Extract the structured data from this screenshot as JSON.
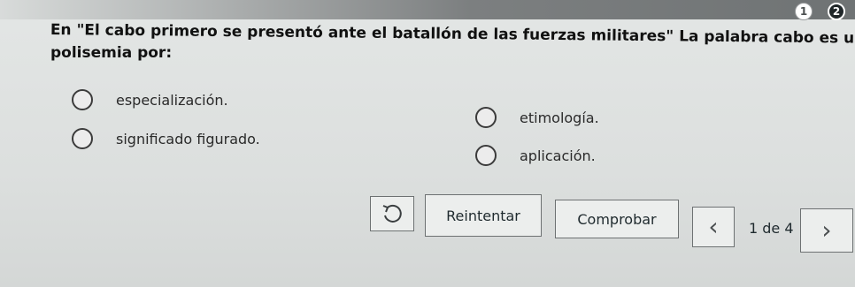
{
  "progress": {
    "steps": [
      "1",
      "2"
    ]
  },
  "question": {
    "line1": "En \"El cabo primero se presentó ante el batallón de las fuerzas militares\" La palabra cabo es un ejemplo de",
    "line2": "polisemia por:"
  },
  "options": [
    {
      "label": "especialización."
    },
    {
      "label": "etimología."
    },
    {
      "label": "significado figurado."
    },
    {
      "label": "aplicación."
    }
  ],
  "controls": {
    "undo_icon": "undo-icon",
    "retry_label": "Reintentar",
    "check_label": "Comprobar",
    "prev_icon": "chevron-left-icon",
    "next_icon": "chevron-right-icon",
    "page_counter": "1 de 4"
  },
  "colors": {
    "active_step": "#1f2628",
    "border": "#6d7172"
  }
}
